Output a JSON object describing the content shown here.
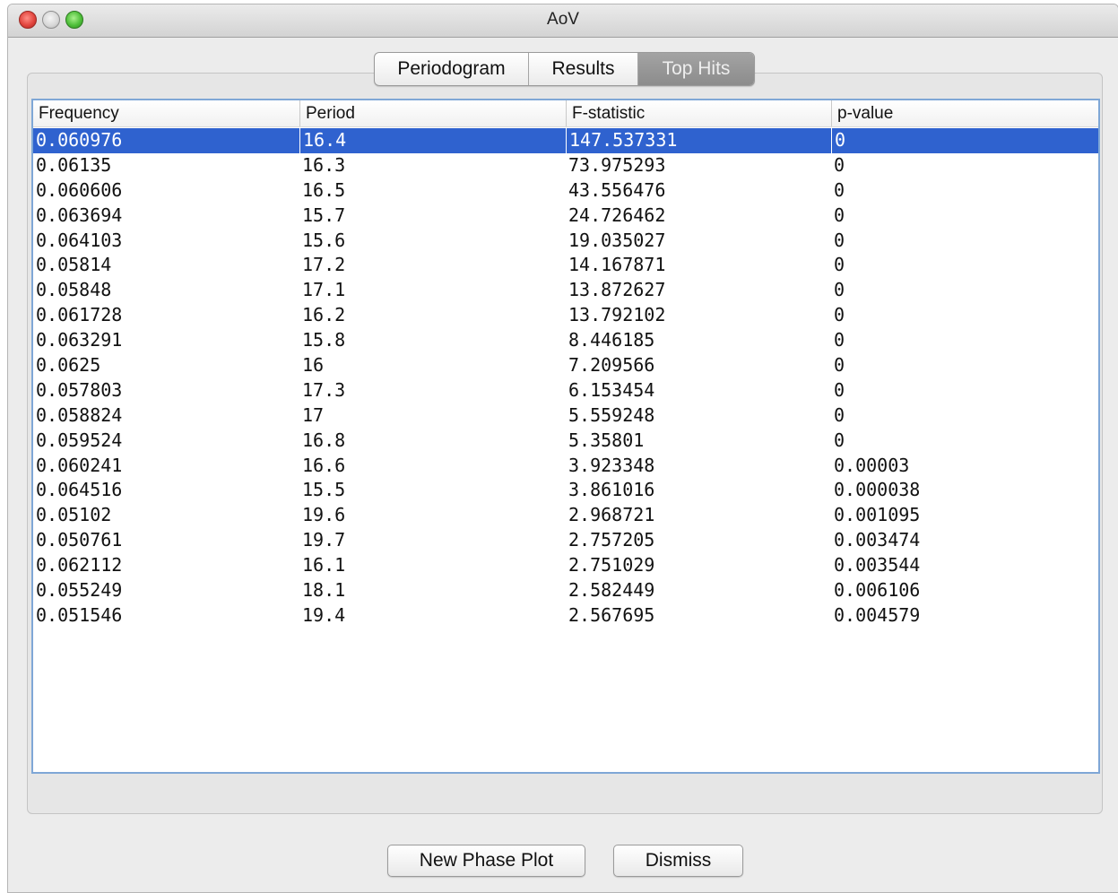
{
  "window": {
    "title": "AoV"
  },
  "tabs": [
    {
      "label": "Periodogram",
      "active": false
    },
    {
      "label": "Results",
      "active": false
    },
    {
      "label": "Top Hits",
      "active": true
    }
  ],
  "table": {
    "columns": [
      "Frequency",
      "Period",
      "F-statistic",
      "p-value"
    ],
    "selected_row": 0,
    "rows": [
      [
        "0.060976",
        "16.4",
        "147.537331",
        "0"
      ],
      [
        "0.06135",
        "16.3",
        "73.975293",
        "0"
      ],
      [
        "0.060606",
        "16.5",
        "43.556476",
        "0"
      ],
      [
        "0.063694",
        "15.7",
        "24.726462",
        "0"
      ],
      [
        "0.064103",
        "15.6",
        "19.035027",
        "0"
      ],
      [
        "0.05814",
        "17.2",
        "14.167871",
        "0"
      ],
      [
        "0.05848",
        "17.1",
        "13.872627",
        "0"
      ],
      [
        "0.061728",
        "16.2",
        "13.792102",
        "0"
      ],
      [
        "0.063291",
        "15.8",
        "8.446185",
        "0"
      ],
      [
        "0.0625",
        "16",
        "7.209566",
        "0"
      ],
      [
        "0.057803",
        "17.3",
        "6.153454",
        "0"
      ],
      [
        "0.058824",
        "17",
        "5.559248",
        "0"
      ],
      [
        "0.059524",
        "16.8",
        "5.35801",
        "0"
      ],
      [
        "0.060241",
        "16.6",
        "3.923348",
        "0.00003"
      ],
      [
        "0.064516",
        "15.5",
        "3.861016",
        "0.000038"
      ],
      [
        "0.05102",
        "19.6",
        "2.968721",
        "0.001095"
      ],
      [
        "0.050761",
        "19.7",
        "2.757205",
        "0.003474"
      ],
      [
        "0.062112",
        "16.1",
        "2.751029",
        "0.003544"
      ],
      [
        "0.055249",
        "18.1",
        "2.582449",
        "0.006106"
      ],
      [
        "0.051546",
        "19.4",
        "2.567695",
        "0.004579"
      ]
    ]
  },
  "buttons": {
    "new_phase_plot": "New Phase Plot",
    "dismiss": "Dismiss"
  },
  "colors": {
    "selection": "#2f62cf",
    "active_tab": "#8c8c8c",
    "table_focus_border": "#7fa7d6"
  }
}
